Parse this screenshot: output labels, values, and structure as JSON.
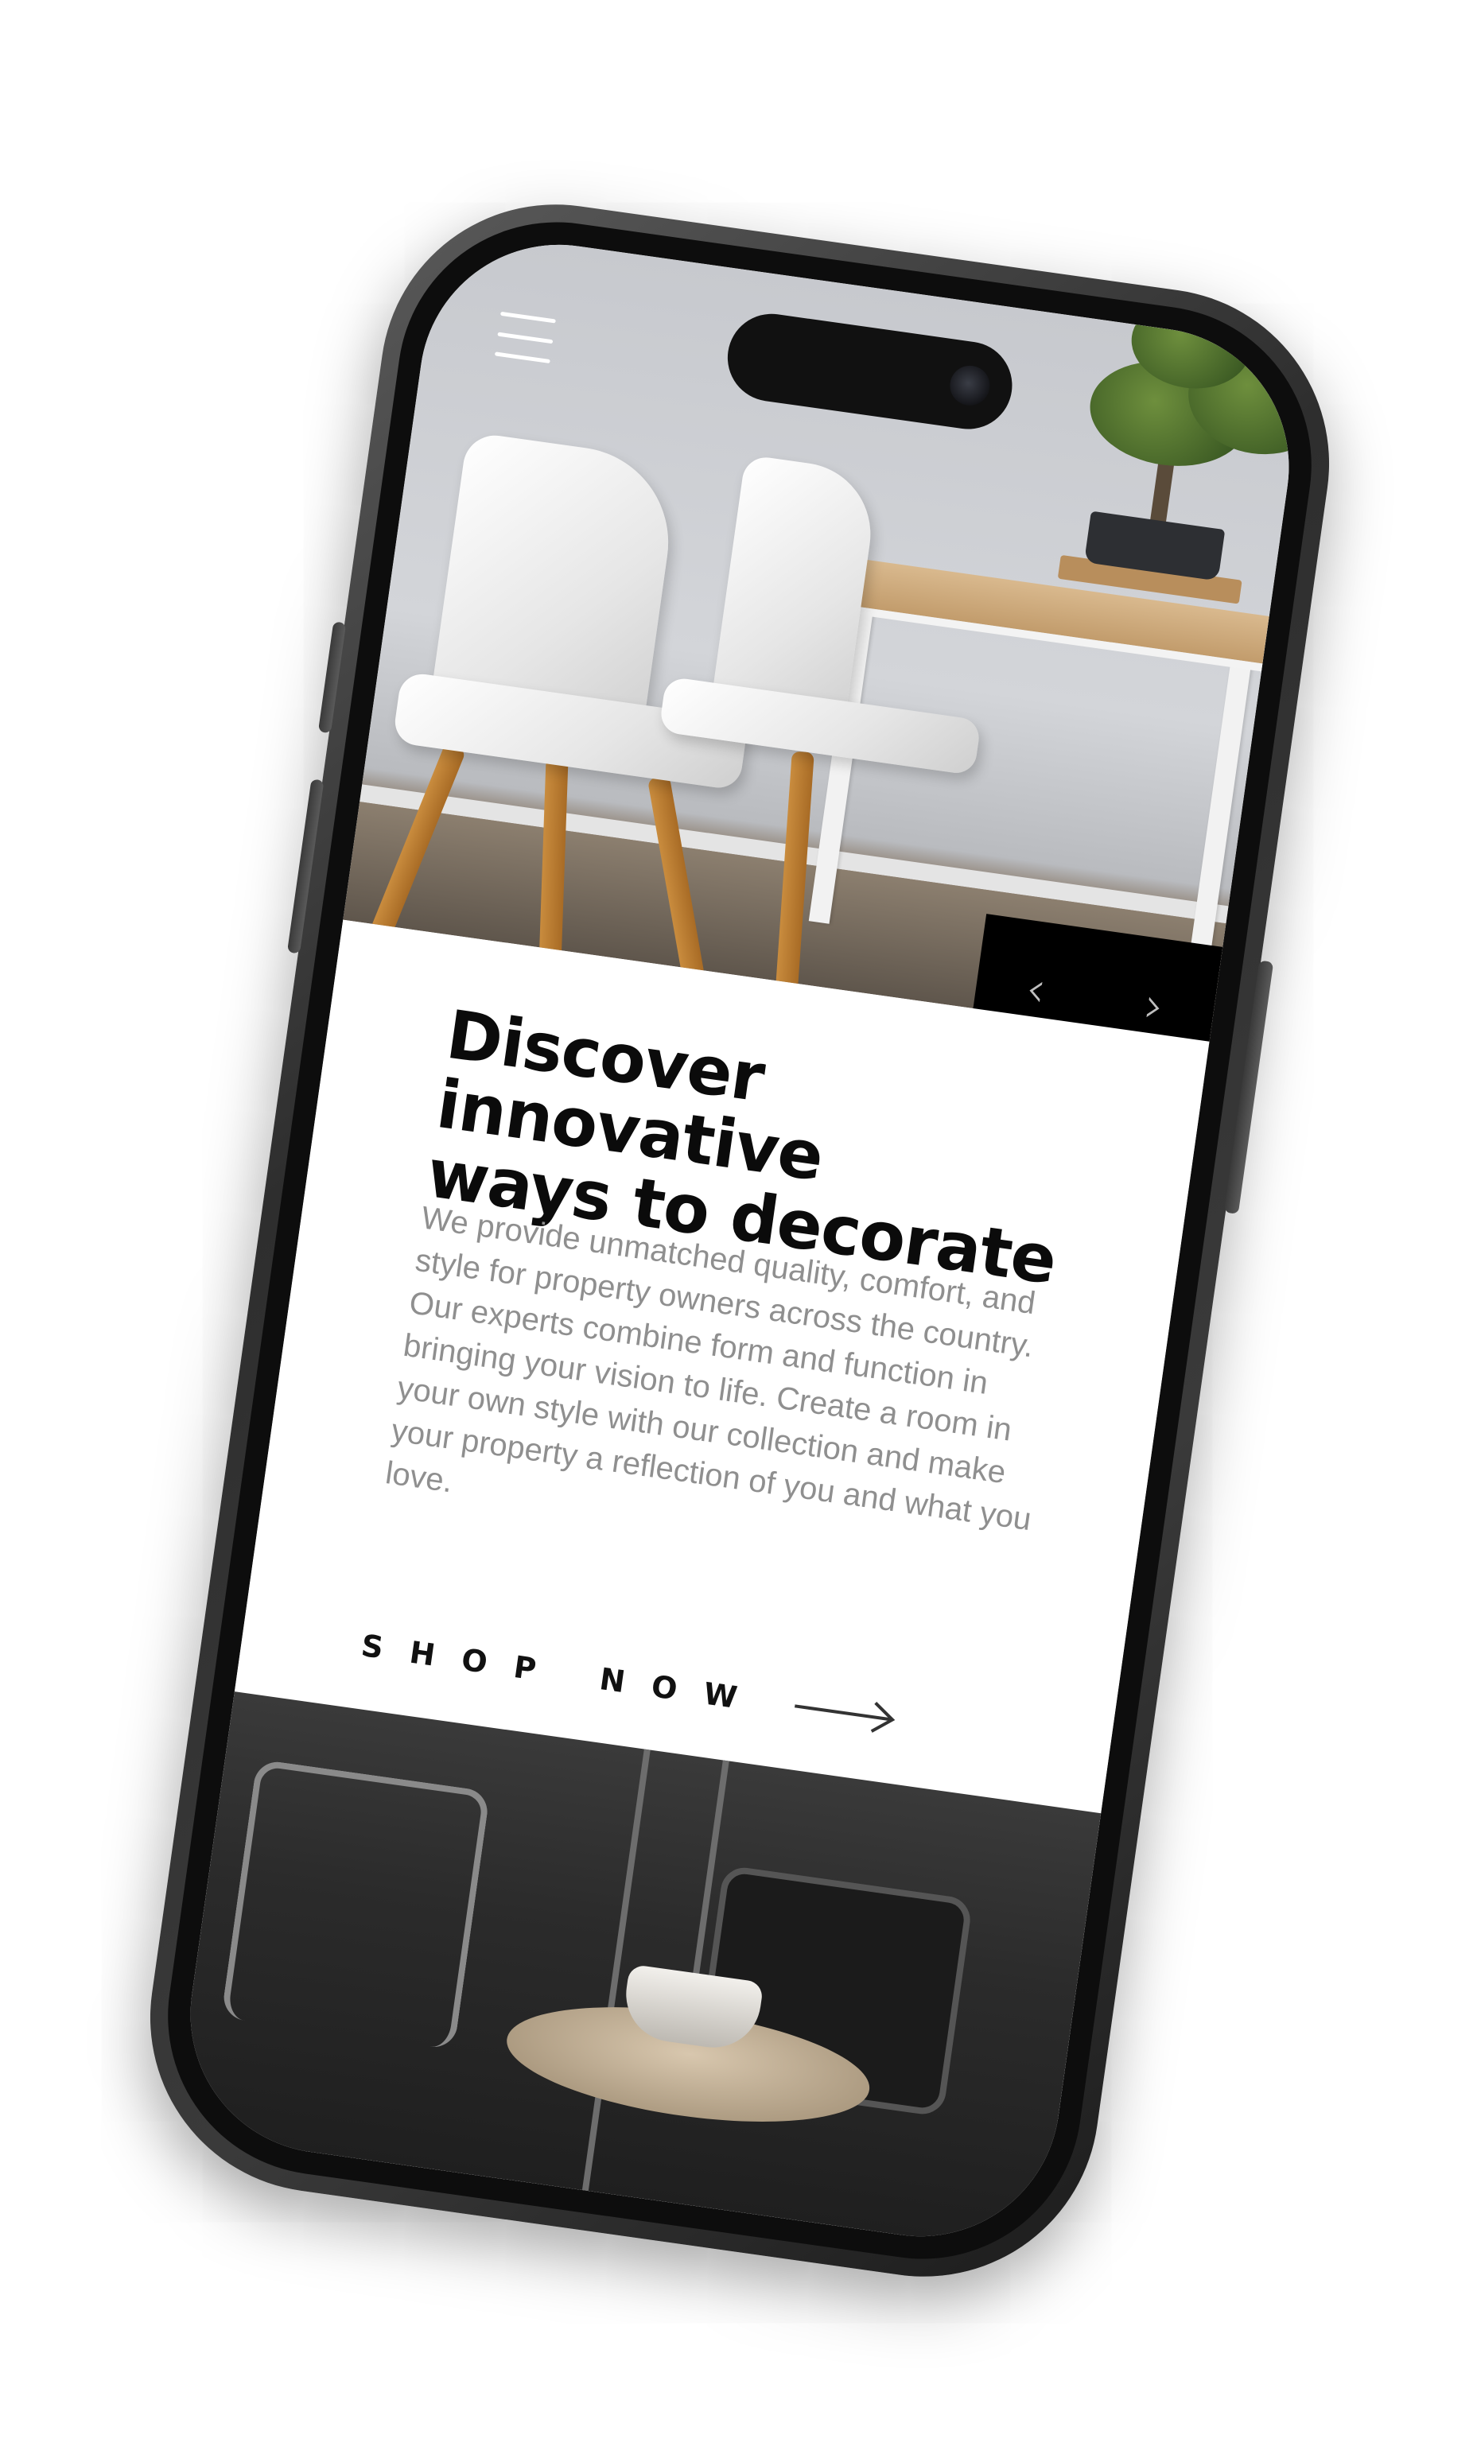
{
  "menu": {
    "icon": "hamburger-menu-icon"
  },
  "slider": {
    "prev_label": "‹",
    "next_label": "›"
  },
  "hero": {
    "title_line_1": "Discover innovative",
    "title_line_2": "ways to decorate",
    "description": "We provide unmatched quality, comfort, and style for property owners across the country. Our experts combine form and function in bringing your vision to life. Create a room in your own style with our collection and make your property a reflection of you and what you love."
  },
  "cta": {
    "label": "SHOP NOW",
    "icon": "arrow-right-icon"
  },
  "colors": {
    "accent": "#000000",
    "text_primary": "#0b0b0b",
    "text_secondary": "#8f8f8f",
    "frame": "#3a3a3a"
  }
}
